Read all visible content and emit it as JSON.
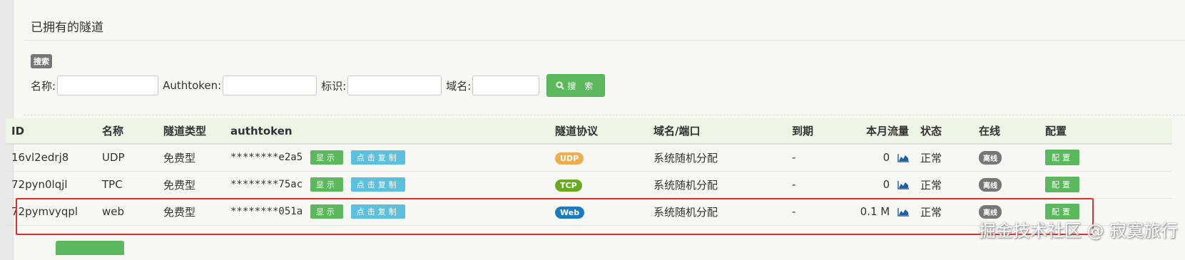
{
  "panel": {
    "title": "已拥有的隧道"
  },
  "search": {
    "badge": "搜索",
    "name_label": "名称:",
    "authtoken_label": "Authtoken:",
    "identifier_label": "标识:",
    "domain_label": "域名:",
    "button_label": "搜 索"
  },
  "table": {
    "headers": {
      "id": "ID",
      "name": "名称",
      "type": "隧道类型",
      "authtoken": "authtoken",
      "protocol": "隧道协议",
      "domain": "域名/端口",
      "expire": "到期",
      "traffic": "本月流量",
      "status": "状态",
      "online": "在线",
      "config": "配置"
    },
    "rows": [
      {
        "id": "16vl2edrj8",
        "name": "UDP",
        "type": "免费型",
        "authtoken": "********e2a5",
        "show": "显示",
        "copy": "点击复制",
        "protocol": "UDP",
        "protocol_color": "#f0ad4e",
        "domain": "系统随机分配",
        "expire": "-",
        "traffic": "0",
        "status": "正常",
        "online": "离线",
        "config": "配置"
      },
      {
        "id": "72pyn0lqjl",
        "name": "TPC",
        "type": "免费型",
        "authtoken": "********75ac",
        "show": "显示",
        "copy": "点击复制",
        "protocol": "TCP",
        "protocol_color": "#6aaa1e",
        "domain": "系统随机分配",
        "expire": "-",
        "traffic": "0",
        "status": "正常",
        "online": "离线",
        "config": "配置"
      },
      {
        "id": "72pymvyqpl",
        "name": "web",
        "type": "免费型",
        "authtoken": "********051a",
        "show": "显示",
        "copy": "点击复制",
        "protocol": "Web",
        "protocol_color": "#1a7bbf",
        "domain": "系统随机分配",
        "expire": "-",
        "traffic": "0.1 M",
        "status": "正常",
        "online": "离线",
        "config": "配置"
      }
    ]
  },
  "watermark": "掘金技术社区 @ 寂寞旅行",
  "icons": {
    "search": "search-icon",
    "chart": "area-chart-icon"
  }
}
